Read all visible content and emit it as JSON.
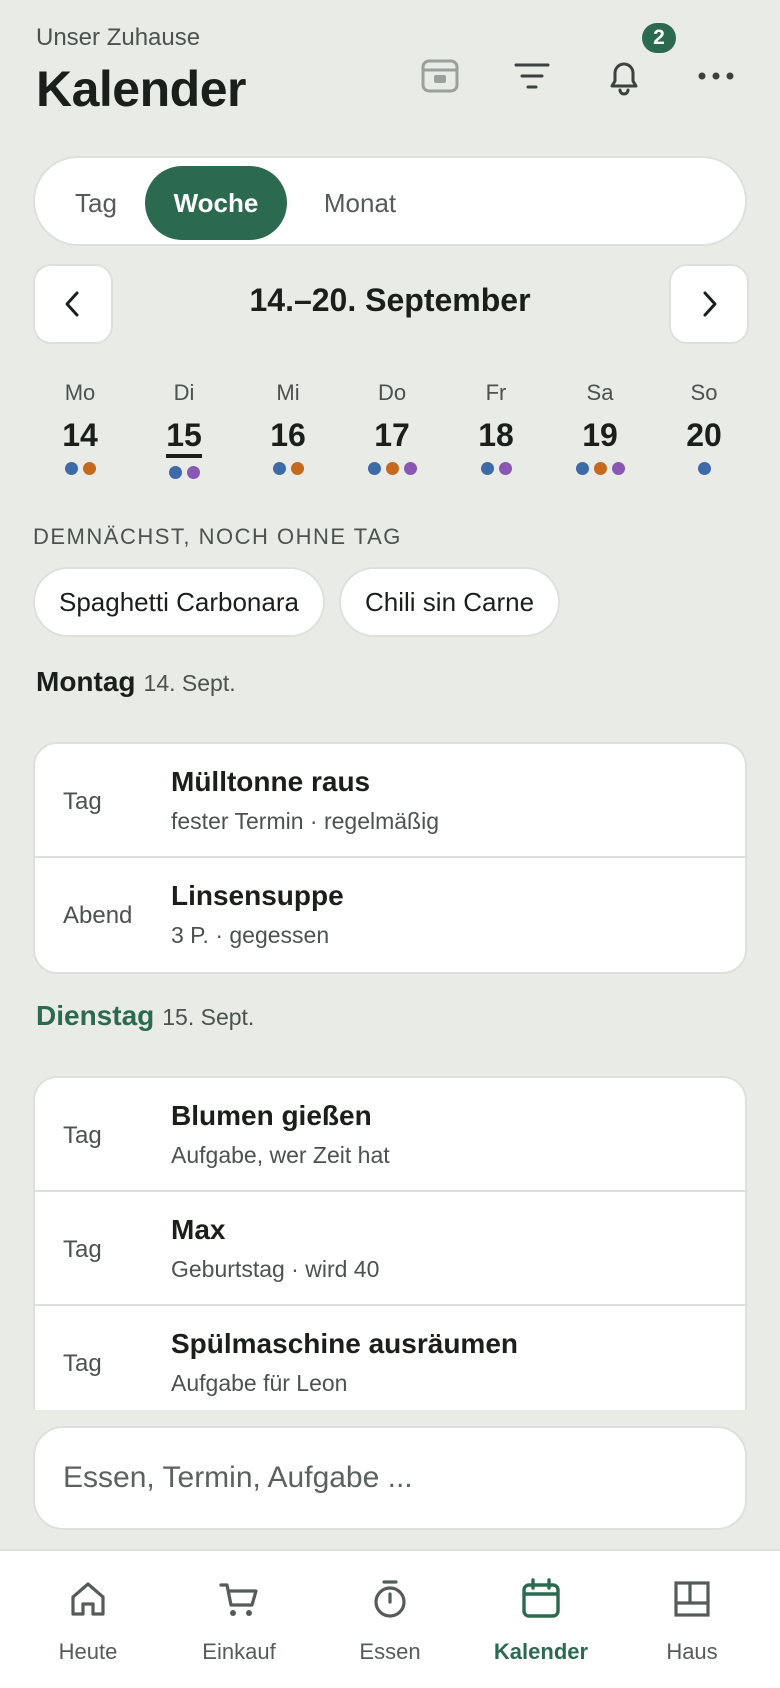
{
  "header": {
    "subtitle": "Unser Zuhause",
    "title": "Kalender",
    "notification_count": "2"
  },
  "view_switch": {
    "tag": "Tag",
    "woche": "Woche",
    "monat": "Monat",
    "selected": "Woche"
  },
  "range_label": "14.–20. September",
  "week": [
    {
      "wd": "Mo",
      "num": "14",
      "dots": [
        "blue",
        "orange"
      ]
    },
    {
      "wd": "Di",
      "num": "15",
      "dots": [
        "blue",
        "purple"
      ],
      "today": true
    },
    {
      "wd": "Mi",
      "num": "16",
      "dots": [
        "blue",
        "orange"
      ]
    },
    {
      "wd": "Do",
      "num": "17",
      "dots": [
        "blue",
        "orange",
        "purple"
      ]
    },
    {
      "wd": "Fr",
      "num": "18",
      "dots": [
        "blue",
        "purple"
      ]
    },
    {
      "wd": "Sa",
      "num": "19",
      "dots": [
        "blue",
        "orange",
        "purple"
      ]
    },
    {
      "wd": "So",
      "num": "20",
      "dots": [
        "blue"
      ]
    }
  ],
  "colors": {
    "accent": "#2c6a4f",
    "blue": "#3f6aa8",
    "orange": "#c36a1c",
    "purple": "#8a58b4"
  },
  "unscheduled": {
    "label": "DEMNÄCHST, NOCH OHNE TAG",
    "chips": [
      "Spaghetti Carbonara",
      "Chili sin Carne"
    ]
  },
  "days": [
    {
      "name": "Montag",
      "date": "14. Sept.",
      "items": [
        {
          "when": "Tag",
          "title": "Mülltonne raus",
          "sub": "fester Termin · regelmäßig"
        },
        {
          "when": "Abend",
          "title": "Linsensuppe",
          "sub": "3 P. · gegessen"
        }
      ]
    },
    {
      "name": "Dienstag",
      "date": "15. Sept.",
      "items": [
        {
          "when": "Tag",
          "title": "Blumen gießen",
          "sub": "Aufgabe, wer Zeit hat"
        },
        {
          "when": "Tag",
          "title": "Max",
          "sub": "Geburtstag · wird 40"
        },
        {
          "when": "Tag",
          "title": "Spülmaschine ausräumen",
          "sub": "Aufgabe für Leon"
        }
      ]
    }
  ],
  "quick_add": {
    "placeholder": "Essen, Termin, Aufgabe ..."
  },
  "tabs": [
    {
      "label": "Heute",
      "icon": "home-icon"
    },
    {
      "label": "Einkauf",
      "icon": "cart-icon"
    },
    {
      "label": "Essen",
      "icon": "timer-icon"
    },
    {
      "label": "Kalender",
      "icon": "calendar-icon",
      "active": true
    },
    {
      "label": "Haus",
      "icon": "layout-icon"
    }
  ]
}
